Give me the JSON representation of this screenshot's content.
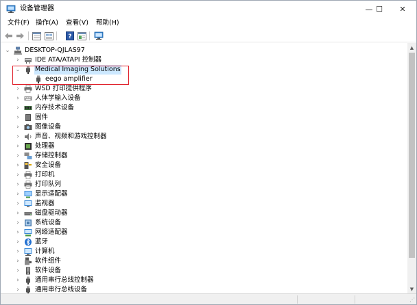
{
  "window": {
    "title": "设备管理器",
    "minimize_glyph": "—",
    "maximize_glyph": "☐",
    "close_glyph": "✕"
  },
  "menu": [
    "文件(F)",
    "操作(A)",
    "查看(V)",
    "帮助(H)"
  ],
  "toolbar": {
    "buttons": [
      "back-arrow-icon",
      "forward-arrow-icon",
      "properties-icon",
      "show-hidden-icon",
      "help-icon",
      "update-driver-icon",
      "scan-hardware-icon"
    ]
  },
  "tree": {
    "computer": "DESKTOP-QJLAS97",
    "items": [
      {
        "label": "IDE ATA/ATAPI 控制器",
        "icon": "ide-controller-icon",
        "expanded": false
      },
      {
        "label": "Medical Imaging Solutions",
        "icon": "usb-device-icon",
        "expanded": true,
        "selected": true
      },
      {
        "label": "eego amplifier",
        "icon": "usb-device-icon",
        "child": true
      },
      {
        "label": "WSD 打印提供程序",
        "icon": "printer-icon",
        "expanded": false
      },
      {
        "label": "人体学输入设备",
        "icon": "keyboard-icon",
        "expanded": false
      },
      {
        "label": "内存技术设备",
        "icon": "memory-icon",
        "expanded": false
      },
      {
        "label": "固件",
        "icon": "firmware-icon",
        "expanded": false
      },
      {
        "label": "图像设备",
        "icon": "camera-icon",
        "expanded": false
      },
      {
        "label": "声音、视频和游戏控制器",
        "icon": "speaker-icon",
        "expanded": false
      },
      {
        "label": "处理器",
        "icon": "processor-icon",
        "expanded": false
      },
      {
        "label": "存储控制器",
        "icon": "storage-controller-icon",
        "expanded": false
      },
      {
        "label": "安全设备",
        "icon": "security-key-icon",
        "expanded": false
      },
      {
        "label": "打印机",
        "icon": "printer-icon",
        "expanded": false
      },
      {
        "label": "打印队列",
        "icon": "print-queue-icon",
        "expanded": false
      },
      {
        "label": "显示适配器",
        "icon": "display-adapter-icon",
        "expanded": false
      },
      {
        "label": "监视器",
        "icon": "monitor-icon",
        "expanded": false
      },
      {
        "label": "磁盘驱动器",
        "icon": "disk-drive-icon",
        "expanded": false
      },
      {
        "label": "系统设备",
        "icon": "system-device-icon",
        "expanded": false
      },
      {
        "label": "网络适配器",
        "icon": "network-adapter-icon",
        "expanded": false
      },
      {
        "label": "蓝牙",
        "icon": "bluetooth-icon",
        "expanded": false
      },
      {
        "label": "计算机",
        "icon": "computer-icon",
        "expanded": false
      },
      {
        "label": "软件组件",
        "icon": "software-component-icon",
        "expanded": false
      },
      {
        "label": "软件设备",
        "icon": "software-device-icon",
        "expanded": false
      },
      {
        "label": "通用串行总线控制器",
        "icon": "usb-controller-icon",
        "expanded": false
      },
      {
        "label": "通用串行总线设备",
        "icon": "usb-device-icon",
        "expanded": false
      }
    ]
  },
  "colors": {
    "selection": "#cce8ff",
    "highlight_border": "#e0212b"
  }
}
